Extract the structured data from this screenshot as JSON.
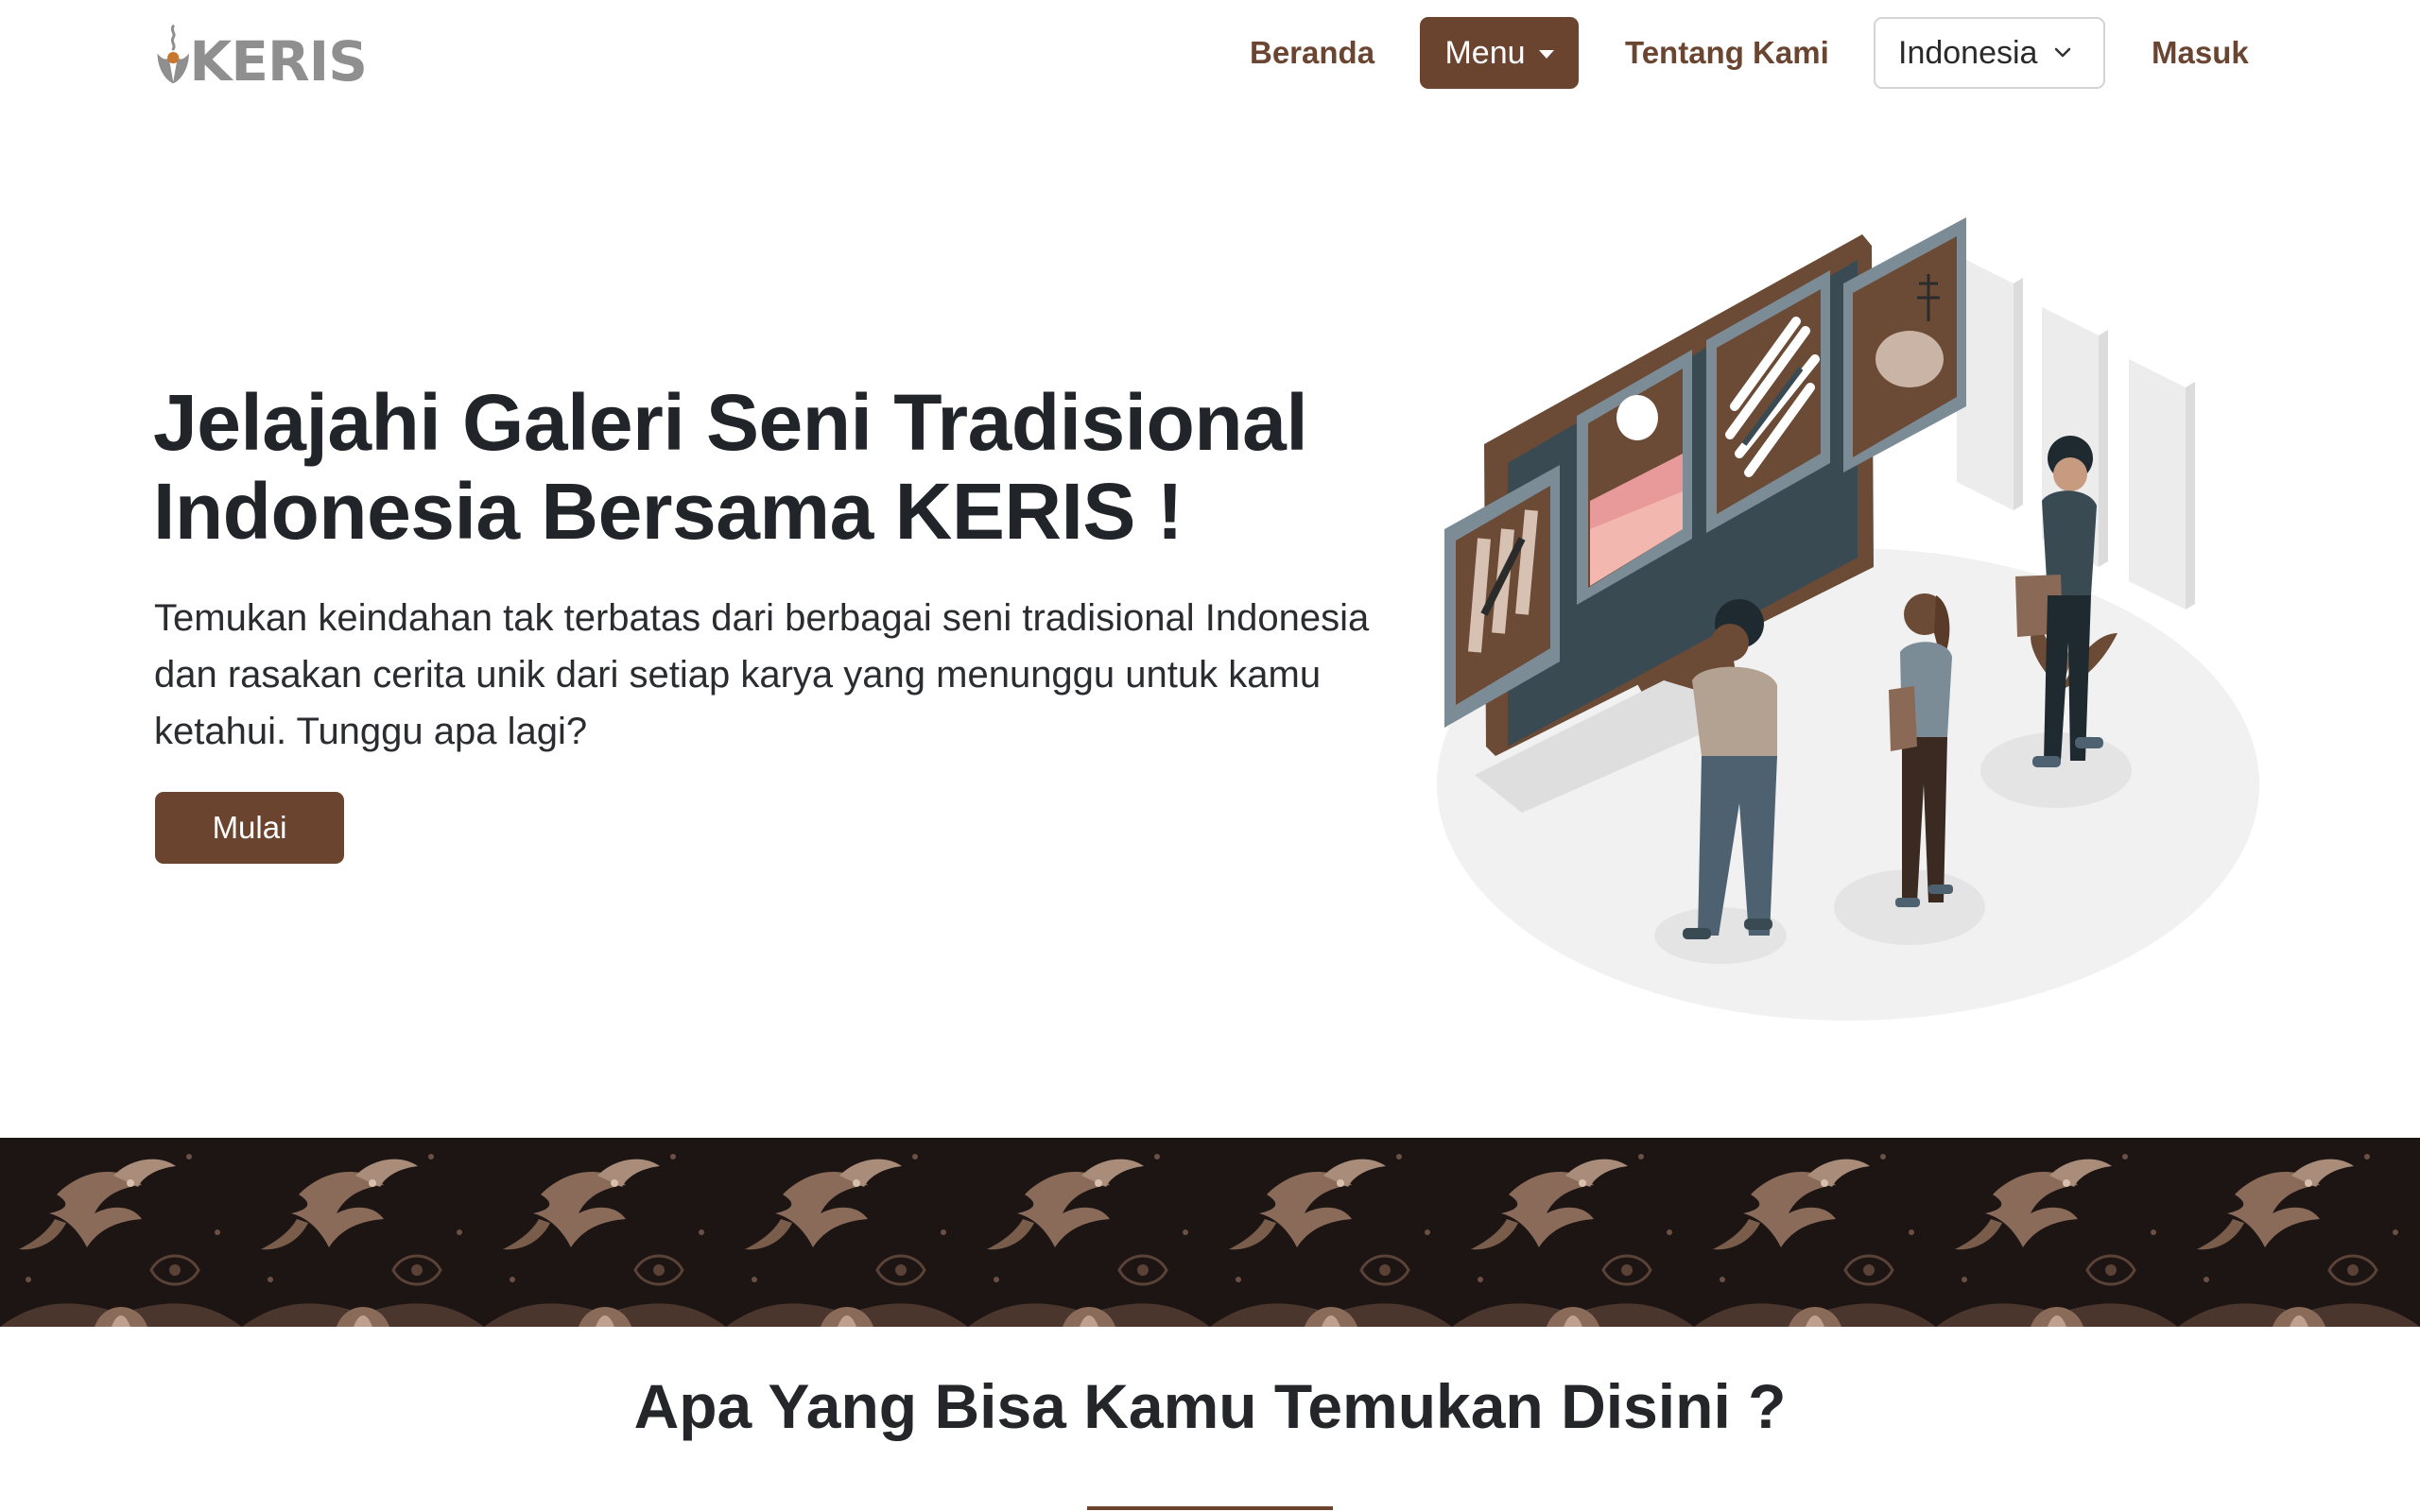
{
  "brand": {
    "logo_text": "KERIS",
    "accent_color": "#6b4430",
    "logo_color": "#8f8f8f"
  },
  "nav": {
    "beranda": "Beranda",
    "menu": "Menu",
    "tentang": "Tentang Kami",
    "language_selected": "Indonesia",
    "masuk": "Masuk"
  },
  "hero": {
    "title": "Jelajahi Galeri Seni Tradisional Indonesia Bersama KERIS !",
    "subtitle": "Temukan keindahan tak terbatas dari berbagai seni tradisional Indonesia dan rasakan cerita unik dari setiap karya yang menunggu untuk kamu ketahui. Tunggu apa lagi?",
    "cta": "Mulai"
  },
  "section": {
    "title": "Apa Yang Bisa Kamu Temukan Disini ?"
  },
  "icons": {
    "logo": "keris-dagger-icon",
    "menu_caret": "caret-down-icon",
    "language_chevron": "chevron-down-icon"
  }
}
